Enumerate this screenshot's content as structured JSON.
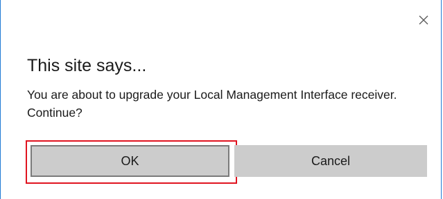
{
  "dialog": {
    "close_icon": "close-icon",
    "title": "This site says...",
    "message": "You are about to upgrade your Local Management Interface receiver. Continue?",
    "ok_label": "OK",
    "cancel_label": "Cancel",
    "highlight_color": "#e0131f",
    "border_color": "#1f7ad4"
  }
}
